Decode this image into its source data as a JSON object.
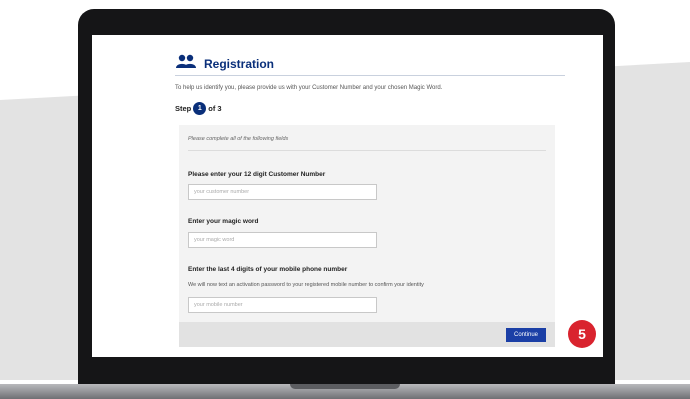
{
  "registration": {
    "title": "Registration",
    "icon": "users-icon",
    "intro": "To help us identify you, please provide us with your Customer Number and your chosen Magic Word.",
    "step_label": "Step",
    "step_current": "1",
    "step_total": "of 3"
  },
  "form": {
    "note": "Please complete all of the following fields",
    "customer_number": {
      "label": "Please enter your 12 digit Customer Number",
      "placeholder": "your customer number"
    },
    "magic_word": {
      "label": "Enter your magic word",
      "placeholder": "your magic word"
    },
    "mobile": {
      "label": "Enter the last 4 digits of your mobile phone number",
      "help": "We will now text an activation password to your registered mobile number to confirm your identity",
      "placeholder": "your mobile number"
    },
    "continue_label": "Continue"
  },
  "badge": {
    "number": "5"
  },
  "colors": {
    "brand_blue": "#0a2f7a",
    "button_blue": "#1b3fa6",
    "badge_red": "#d9232e"
  }
}
